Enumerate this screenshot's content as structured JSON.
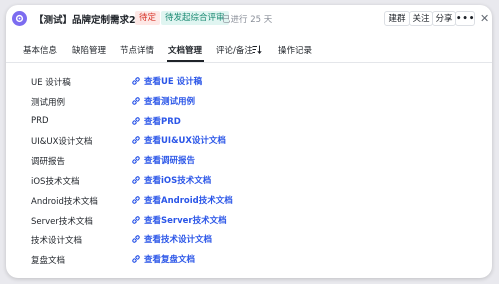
{
  "header": {
    "title": "【测试】品牌定制需求2期",
    "status_badge": "待定",
    "stage_badge": "待发起综合评审",
    "progress_text": "已进行 25 天",
    "buttons": {
      "requirement_group": "建群",
      "follow": "关注",
      "share": "分享",
      "more": "•••",
      "close": "✕"
    }
  },
  "tabs": [
    {
      "label": "基本信息"
    },
    {
      "label": "缺陷管理"
    },
    {
      "label": "节点详情"
    },
    {
      "label": "文档管理",
      "active": true
    },
    {
      "label": "评论/备注"
    },
    {
      "label": "操作记录"
    }
  ],
  "documents": [
    {
      "label": "UE 设计稿",
      "link": "查看UE 设计稿"
    },
    {
      "label": "测试用例",
      "link": "查看测试用例"
    },
    {
      "label": "PRD",
      "link": "查看PRD"
    },
    {
      "label": "UI&UX设计文档",
      "link": "查看UI&UX设计文档"
    },
    {
      "label": "调研报告",
      "link": "查看调研报告"
    },
    {
      "label": "iOS技术文档",
      "link": "查看iOS技术文档"
    },
    {
      "label": "Android技术文档",
      "link": "查看Android技术文档"
    },
    {
      "label": "Server技术文档",
      "link": "查看Server技术文档"
    },
    {
      "label": "技术设计文档",
      "link": "查看技术设计文档"
    },
    {
      "label": "复盘文档",
      "link": "查看复盘文档"
    }
  ],
  "icons": {
    "app": "app-logo-icon",
    "sort": "sort-filter-icon",
    "link": "link-icon"
  },
  "colors": {
    "accent_link": "#2b56e8",
    "status_red": "#d8352a",
    "stage_green": "#1b8a73",
    "app_purple": "#7c6cf0"
  }
}
